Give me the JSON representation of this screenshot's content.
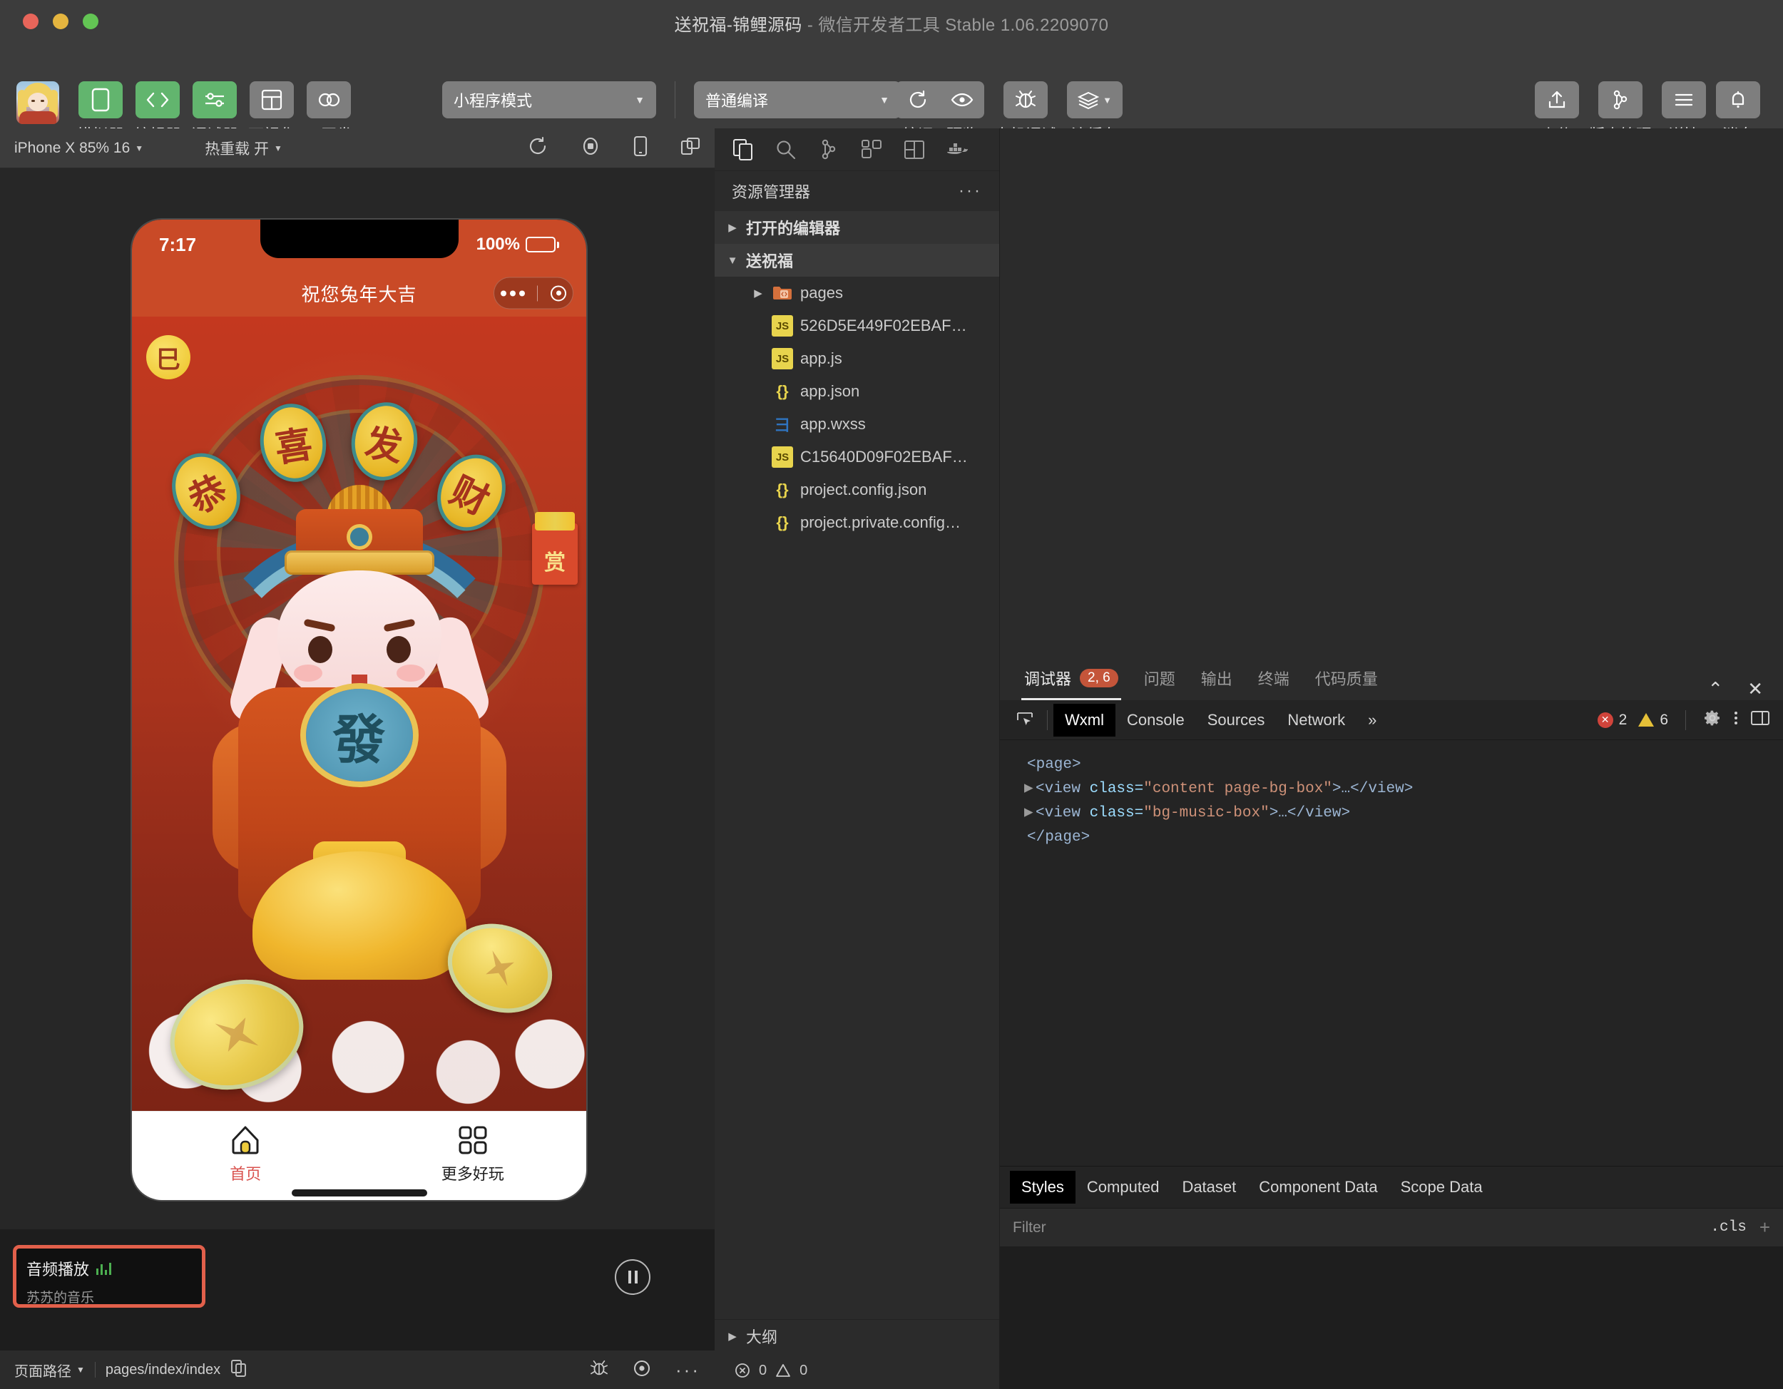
{
  "window": {
    "title_main": "送祝福-锦鲤源码",
    "title_sep": " - ",
    "title_sub": "微信开发者工具 Stable 1.06.2209070"
  },
  "toolbar": {
    "items": [
      {
        "label": "模拟器",
        "icon": "phone-icon",
        "active": true
      },
      {
        "label": "编辑器",
        "icon": "code-icon",
        "active": true
      },
      {
        "label": "调试器",
        "icon": "sliders-icon",
        "active": true
      },
      {
        "label": "可视化",
        "icon": "layout-icon",
        "active": false
      },
      {
        "label": "云开发",
        "icon": "cloud-icon",
        "active": false
      }
    ],
    "mode_select": "小程序模式",
    "compile_select": "普通编译",
    "actions": [
      {
        "label": "编译",
        "icon": "refresh-icon"
      },
      {
        "label": "预览",
        "icon": "eye-icon"
      },
      {
        "label": "真机调试",
        "icon": "bug-icon"
      },
      {
        "label": "清缓存",
        "icon": "layers-icon"
      }
    ],
    "right_actions": [
      {
        "label": "上传",
        "icon": "upload-icon"
      },
      {
        "label": "版本管理",
        "icon": "git-branch-icon"
      },
      {
        "label": "详情",
        "icon": "menu-icon"
      },
      {
        "label": "消息",
        "icon": "bell-icon"
      }
    ]
  },
  "simulator_bar": {
    "device": "iPhone X 85% 16",
    "hot_reload": "热重载 开",
    "icons": [
      "rotate-icon",
      "record-icon",
      "device-icon",
      "window-icon"
    ]
  },
  "phone": {
    "status": {
      "time": "7:17",
      "battery_pct": "100%"
    },
    "nav_title": "祝您兔年大吉",
    "corner_badge": "巳",
    "reward_label": "赏",
    "medallions": [
      "恭",
      "喜",
      "发",
      "财"
    ],
    "robe_char": "發",
    "tabbar": [
      {
        "label": "首页",
        "icon": "home-icon",
        "active": true
      },
      {
        "label": "更多好玩",
        "icon": "grid-icon",
        "active": false
      }
    ]
  },
  "audio_player": {
    "title": "音频播放",
    "subtitle": "苏苏的音乐",
    "control": "pause-icon",
    "highlight_color": "#e2604b"
  },
  "status_bar": {
    "left_label": "页面路径",
    "path": "pages/index/index",
    "copy_icon": "copy-icon",
    "right_icons": [
      "bug-icon",
      "target-icon",
      "more-icon"
    ]
  },
  "explorer": {
    "icon_bar": [
      "files-icon",
      "search-icon",
      "source-control-icon",
      "extensions-icon",
      "editor-layout-icon",
      "docker-icon"
    ],
    "title": "资源管理器",
    "more": "···",
    "sections": [
      {
        "label": "打开的编辑器",
        "expanded": false
      },
      {
        "label": "送祝福",
        "expanded": true
      }
    ],
    "files": [
      {
        "name": "pages",
        "type": "folder",
        "expanded": false,
        "depth": 1
      },
      {
        "name": "526D5E449F02EBAF…",
        "type": "js",
        "depth": 2
      },
      {
        "name": "app.js",
        "type": "js",
        "depth": 2
      },
      {
        "name": "app.json",
        "type": "json",
        "depth": 2
      },
      {
        "name": "app.wxss",
        "type": "wxss",
        "depth": 2
      },
      {
        "name": "C15640D09F02EBAF…",
        "type": "js",
        "depth": 2
      },
      {
        "name": "project.config.json",
        "type": "json",
        "depth": 2
      },
      {
        "name": "project.private.config…",
        "type": "json",
        "depth": 2
      }
    ],
    "outline": "大纲",
    "status": {
      "errors": "0",
      "warnings": "0"
    }
  },
  "debugger": {
    "panel_tabs": [
      {
        "label": "调试器",
        "badge": "2, 6",
        "active": true
      },
      {
        "label": "问题",
        "badge": "",
        "active": false
      },
      {
        "label": "输出",
        "badge": "",
        "active": false
      },
      {
        "label": "终端",
        "badge": "",
        "active": false
      },
      {
        "label": "代码质量",
        "badge": "",
        "active": false
      }
    ],
    "collapse_icon": "chevron-up-icon",
    "close_icon": "close-icon",
    "devtools_tabs": [
      {
        "label": "Wxml",
        "active": true
      },
      {
        "label": "Console",
        "active": false
      },
      {
        "label": "Sources",
        "active": false
      },
      {
        "label": "Network",
        "active": false
      },
      {
        "label": "»",
        "active": false
      }
    ],
    "error_count": "2",
    "warning_count": "6",
    "right_icons": [
      "gear-icon",
      "kebab-icon",
      "dock-icon"
    ],
    "wxml_lines": [
      {
        "indent": 0,
        "triangle": false,
        "text": "<page>",
        "kind": "tag"
      },
      {
        "indent": 1,
        "triangle": true,
        "tag_open": "<view ",
        "attr": "class=",
        "value": "\"content page-bg-box\"",
        "tail": ">…</view>"
      },
      {
        "indent": 1,
        "triangle": true,
        "tag_open": "<view ",
        "attr": "class=",
        "value": "\"bg-music-box\"",
        "tail": ">…</view>"
      },
      {
        "indent": 0,
        "triangle": false,
        "text": "</page>",
        "kind": "tag"
      }
    ]
  },
  "styles_panel": {
    "tabs": [
      {
        "label": "Styles",
        "active": true
      },
      {
        "label": "Computed",
        "active": false
      },
      {
        "label": "Dataset",
        "active": false
      },
      {
        "label": "Component Data",
        "active": false
      },
      {
        "label": "Scope Data",
        "active": false
      }
    ],
    "filter_placeholder": "Filter",
    "filter_value": "",
    "cls_label": ".cls",
    "plus": "+"
  }
}
